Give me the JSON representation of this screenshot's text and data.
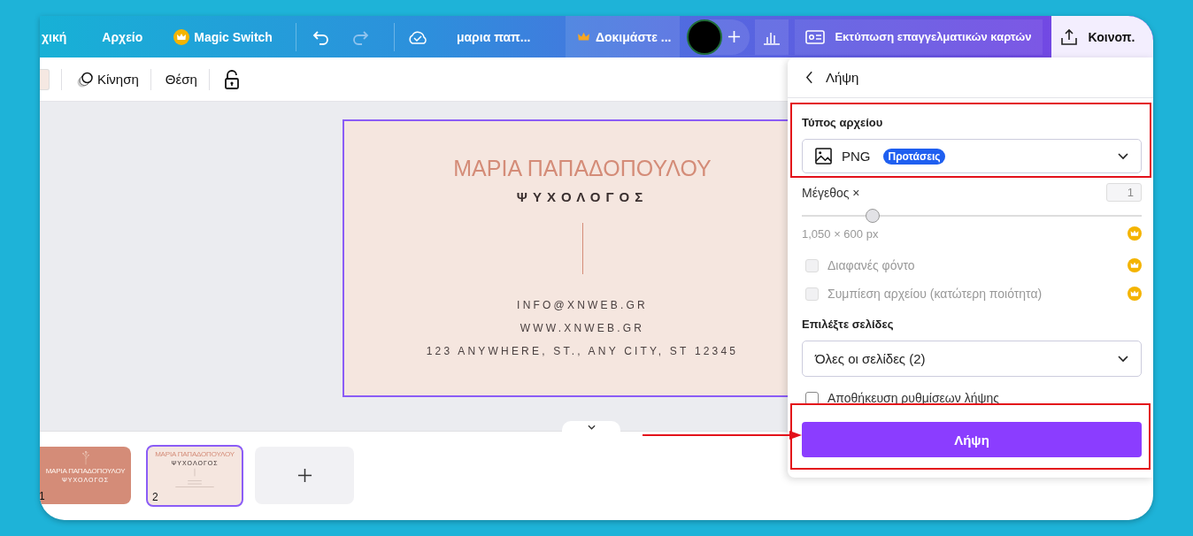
{
  "top_bar": {
    "nav": [
      {
        "label": "χική",
        "kind": "plain"
      },
      {
        "label": "Αρχείο",
        "kind": "plain"
      },
      {
        "label": "Magic Switch",
        "kind": "premium"
      }
    ],
    "design_title": "μαρια παπ...",
    "trial": "Δοκιμάστε ...",
    "print_button": "Εκτύπωση επαγγελματικών καρτών",
    "share_button": "Κοινοπ."
  },
  "toolbar": {
    "items": [
      {
        "label": "Κίνηση",
        "kind": "animate"
      },
      {
        "label": "Θέση",
        "kind": "plain"
      }
    ]
  },
  "card": {
    "name": "ΜΑΡΙΑ ΠΑΠΑΔΟΠΟΥΛΟΥ",
    "title": "ΨΥΧΟΛΟΓΟΣ",
    "contacts": [
      "INFO@XNWEB.GR",
      "WWW.XNWEB.GR",
      "123 ANYWHERE, ST., ANY CITY, ST 12345"
    ]
  },
  "pages": [
    {
      "number": "1",
      "kind": "front",
      "selected": false,
      "name": "ΜΑΡΙΑ ΠΑΠΑΔΟΠΟΥΛΟΥ",
      "title": "ΨΥΧΟΛΟΓΟΣ"
    },
    {
      "number": "2",
      "kind": "back",
      "selected": true,
      "name": "ΜΑΡΙΑ ΠΑΠΑΔΟΠΟΥΛΟΥ",
      "title": "ΨΥΧΟΛΟΓΟΣ"
    }
  ],
  "download_panel": {
    "title": "Λήψη",
    "file_type_label": "Τύπος αρχείου",
    "file_type": "PNG",
    "file_type_badge": "Προτάσεις",
    "size_label": "Μέγεθος ×",
    "size_value": "1",
    "size_slider": {
      "level": 0.19
    },
    "dimensions": "1,050 × 600 px",
    "options": [
      {
        "label": "Διαφανές φόντο",
        "checked": false,
        "disabled": true
      },
      {
        "label": "Συμπίεση αρχείου (κατώτερη ποιότητα)",
        "checked": false,
        "disabled": true
      }
    ],
    "pages_label": "Επιλέξτε σελίδες",
    "pages_value": "Όλες οι σελίδες (2)",
    "save_settings": {
      "label": "Αποθήκευση ρυθμίσεων λήψης",
      "checked": false
    },
    "download_button": "Λήψη"
  }
}
